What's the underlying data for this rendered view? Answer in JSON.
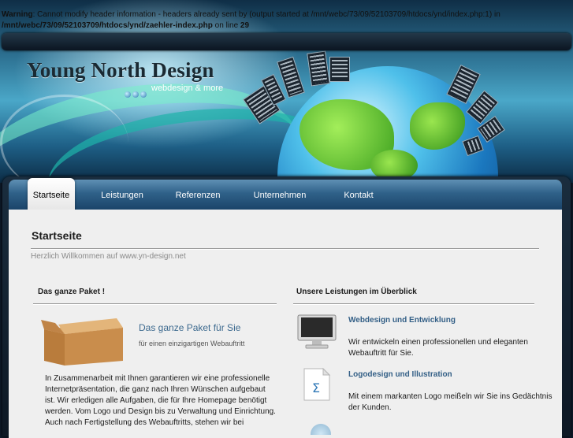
{
  "warning": {
    "label": "Warning",
    "message_part1": ": Cannot modify header information - headers already sent by (output started at /mnt/webc/73/09/52103709/htdocs/ynd/index.php:1) in",
    "file": "/mnt/webc/73/09/52103709/htdocs/ynd/zaehler-index.php",
    "on_line": "on line",
    "line_number": "29"
  },
  "logo": {
    "title": "Young North Design",
    "subtitle": "webdesign & more"
  },
  "nav": {
    "items": [
      {
        "label": "Startseite",
        "active": true
      },
      {
        "label": "Leistungen",
        "active": false
      },
      {
        "label": "Referenzen",
        "active": false
      },
      {
        "label": "Unternehmen",
        "active": false
      },
      {
        "label": "Kontakt",
        "active": false
      }
    ]
  },
  "page": {
    "title": "Startseite",
    "welcome": "Herzlich Willkommen auf www.yn-design.net"
  },
  "left_column": {
    "heading": "Das ganze Paket !",
    "feature_title": "Das ganze Paket für Sie",
    "feature_sub": "für einen einzigartigen Webauftritt",
    "paragraph": "In Zusammenarbeit mit Ihnen garantieren wir eine professionelle Internetpräsentation, die ganz nach Ihren Wünschen aufgebaut ist. Wir erledigen alle Aufgaben, die für Ihre Homepage benötigt werden. Vom Logo und Design bis zu Verwaltung und Einrichtung. Auch nach Fertigstellung des Webauftritts, stehen wir bei"
  },
  "right_column": {
    "heading": "Unsere Leistungen im Überblick",
    "services": [
      {
        "title": "Webdesign und Entwicklung",
        "text": "Wir entwickeln einen professionellen und eleganten Webauftritt für Sie.",
        "icon": "monitor-icon"
      },
      {
        "title": "Logodesign und Illustration",
        "text": "Mit einem markanten Logo meißeln wir Sie ins Gedächtnis der Kunden.",
        "icon": "document-icon"
      }
    ]
  },
  "colors": {
    "accent": "#3d6a8f",
    "nav_bg": "#2f6189",
    "content_bg": "#efefef"
  }
}
